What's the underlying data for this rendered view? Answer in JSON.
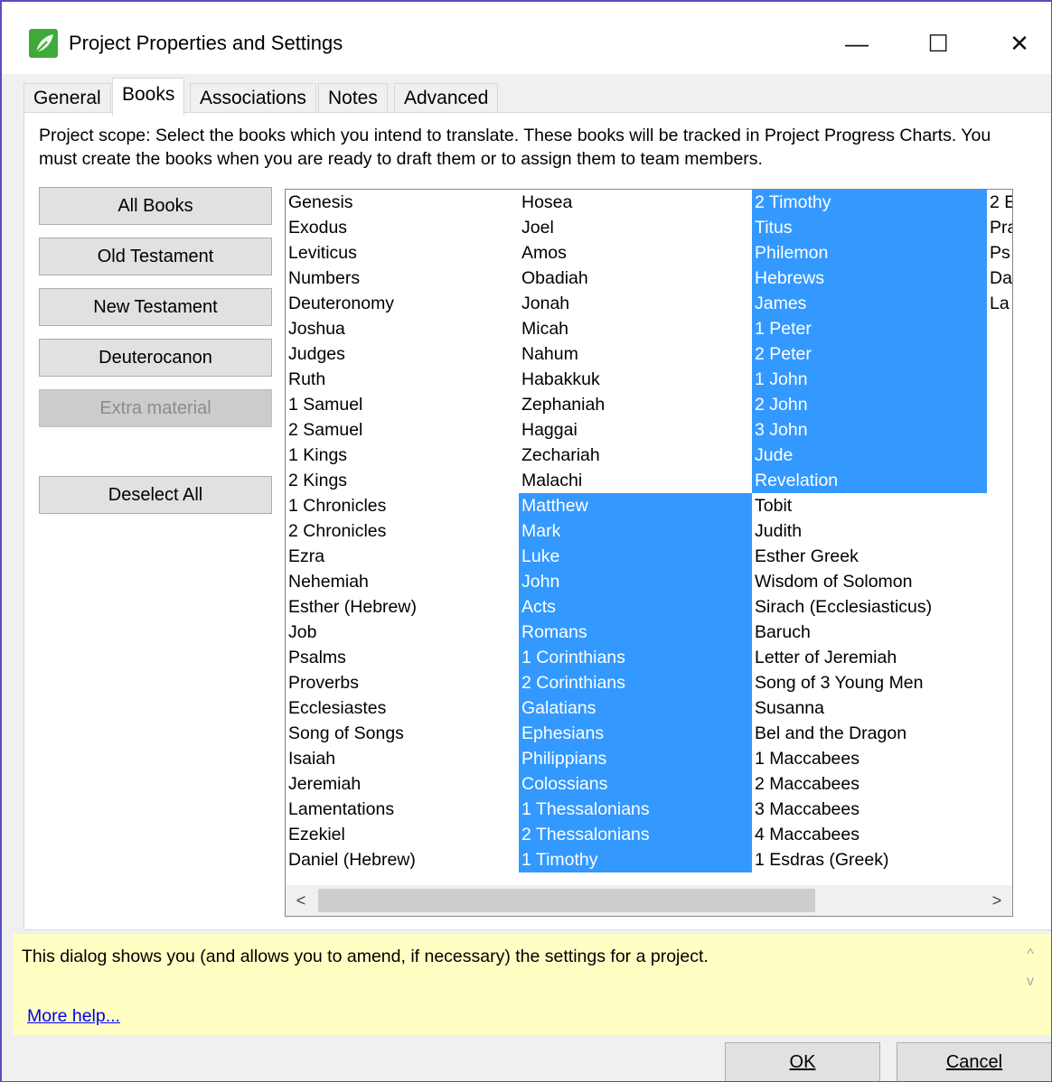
{
  "window": {
    "title": "Project Properties and Settings",
    "controls": {
      "minimize": "—",
      "maximize": "☐",
      "close": "✕"
    }
  },
  "tabs": [
    "General",
    "Books",
    "Associations",
    "Notes",
    "Advanced"
  ],
  "active_tab": "Books",
  "scope_text": "Project scope: Select the books which you intend to translate. These books will be tracked in Project Progress Charts. You must create the books when you are ready to draft them or to assign them to team members.",
  "buttons": {
    "all_books": "All Books",
    "old_testament": "Old Testament",
    "new_testament": "New Testament",
    "deuterocanon": "Deuterocanon",
    "extra_material": "Extra material",
    "deselect_all": "Deselect All"
  },
  "books": {
    "col1": [
      {
        "name": "Genesis",
        "selected": false
      },
      {
        "name": "Exodus",
        "selected": false
      },
      {
        "name": "Leviticus",
        "selected": false
      },
      {
        "name": "Numbers",
        "selected": false
      },
      {
        "name": "Deuteronomy",
        "selected": false
      },
      {
        "name": "Joshua",
        "selected": false
      },
      {
        "name": "Judges",
        "selected": false
      },
      {
        "name": "Ruth",
        "selected": false
      },
      {
        "name": "1 Samuel",
        "selected": false
      },
      {
        "name": "2 Samuel",
        "selected": false
      },
      {
        "name": "1 Kings",
        "selected": false
      },
      {
        "name": "2 Kings",
        "selected": false
      },
      {
        "name": "1 Chronicles",
        "selected": false
      },
      {
        "name": "2 Chronicles",
        "selected": false
      },
      {
        "name": "Ezra",
        "selected": false
      },
      {
        "name": "Nehemiah",
        "selected": false
      },
      {
        "name": "Esther (Hebrew)",
        "selected": false
      },
      {
        "name": "Job",
        "selected": false
      },
      {
        "name": "Psalms",
        "selected": false
      },
      {
        "name": "Proverbs",
        "selected": false
      },
      {
        "name": "Ecclesiastes",
        "selected": false
      },
      {
        "name": "Song of Songs",
        "selected": false
      },
      {
        "name": "Isaiah",
        "selected": false
      },
      {
        "name": "Jeremiah",
        "selected": false
      },
      {
        "name": "Lamentations",
        "selected": false
      },
      {
        "name": "Ezekiel",
        "selected": false
      },
      {
        "name": "Daniel (Hebrew)",
        "selected": false
      }
    ],
    "col2": [
      {
        "name": "Hosea",
        "selected": false
      },
      {
        "name": "Joel",
        "selected": false
      },
      {
        "name": "Amos",
        "selected": false
      },
      {
        "name": "Obadiah",
        "selected": false
      },
      {
        "name": "Jonah",
        "selected": false
      },
      {
        "name": "Micah",
        "selected": false
      },
      {
        "name": "Nahum",
        "selected": false
      },
      {
        "name": "Habakkuk",
        "selected": false
      },
      {
        "name": "Zephaniah",
        "selected": false
      },
      {
        "name": "Haggai",
        "selected": false
      },
      {
        "name": "Zechariah",
        "selected": false
      },
      {
        "name": "Malachi",
        "selected": false
      },
      {
        "name": "Matthew",
        "selected": true
      },
      {
        "name": "Mark",
        "selected": true
      },
      {
        "name": "Luke",
        "selected": true
      },
      {
        "name": "John",
        "selected": true
      },
      {
        "name": "Acts",
        "selected": true
      },
      {
        "name": "Romans",
        "selected": true
      },
      {
        "name": "1 Corinthians",
        "selected": true
      },
      {
        "name": "2 Corinthians",
        "selected": true
      },
      {
        "name": "Galatians",
        "selected": true
      },
      {
        "name": "Ephesians",
        "selected": true
      },
      {
        "name": "Philippians",
        "selected": true
      },
      {
        "name": "Colossians",
        "selected": true
      },
      {
        "name": "1 Thessalonians",
        "selected": true
      },
      {
        "name": "2 Thessalonians",
        "selected": true
      },
      {
        "name": "1 Timothy",
        "selected": true
      }
    ],
    "col3": [
      {
        "name": "2 Timothy",
        "selected": true
      },
      {
        "name": "Titus",
        "selected": true
      },
      {
        "name": "Philemon",
        "selected": true
      },
      {
        "name": "Hebrews",
        "selected": true
      },
      {
        "name": "James",
        "selected": true
      },
      {
        "name": "1 Peter",
        "selected": true
      },
      {
        "name": "2 Peter",
        "selected": true
      },
      {
        "name": "1 John",
        "selected": true
      },
      {
        "name": "2 John",
        "selected": true
      },
      {
        "name": "3 John",
        "selected": true
      },
      {
        "name": "Jude",
        "selected": true
      },
      {
        "name": "Revelation",
        "selected": true
      },
      {
        "name": "Tobit",
        "selected": false
      },
      {
        "name": "Judith",
        "selected": false
      },
      {
        "name": "Esther Greek",
        "selected": false
      },
      {
        "name": "Wisdom of Solomon",
        "selected": false
      },
      {
        "name": "Sirach (Ecclesiasticus)",
        "selected": false
      },
      {
        "name": "Baruch",
        "selected": false
      },
      {
        "name": "Letter of Jeremiah",
        "selected": false
      },
      {
        "name": "Song of 3 Young Men",
        "selected": false
      },
      {
        "name": "Susanna",
        "selected": false
      },
      {
        "name": "Bel and the Dragon",
        "selected": false
      },
      {
        "name": "1 Maccabees",
        "selected": false
      },
      {
        "name": "2 Maccabees",
        "selected": false
      },
      {
        "name": "3 Maccabees",
        "selected": false
      },
      {
        "name": "4 Maccabees",
        "selected": false
      },
      {
        "name": "1 Esdras (Greek)",
        "selected": false
      }
    ],
    "col4": [
      {
        "name": "2 E",
        "selected": false
      },
      {
        "name": "Pra",
        "selected": false
      },
      {
        "name": "Ps",
        "selected": false
      },
      {
        "name": "Da",
        "selected": false
      },
      {
        "name": "La",
        "selected": false
      }
    ]
  },
  "scroll_arrows": {
    "left": "<",
    "right": ">",
    "up": "^",
    "down": "v"
  },
  "help": {
    "text": "This dialog shows you (and allows you to amend, if necessary) the settings for a project.",
    "link": "More help..."
  },
  "dialog_buttons": {
    "ok": "OK",
    "cancel": "Cancel"
  },
  "colors": {
    "selection": "#3399ff",
    "help_background": "#ffffc4",
    "accent": "#5a4cc2"
  }
}
